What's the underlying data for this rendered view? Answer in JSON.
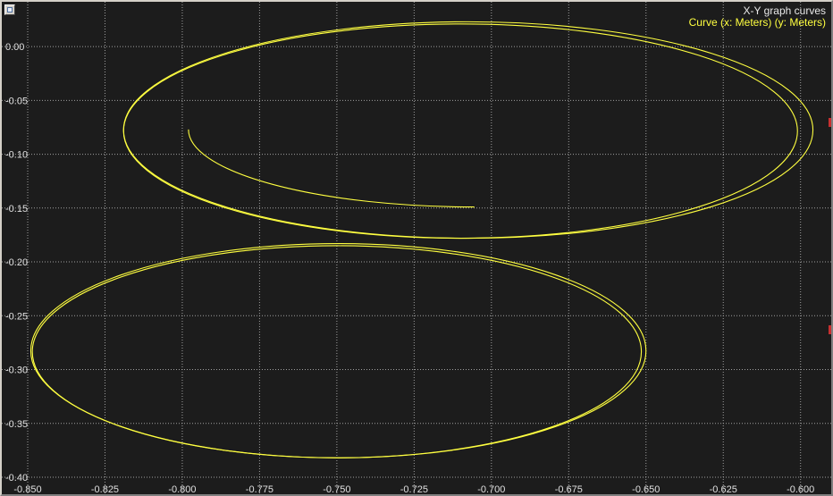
{
  "window": {
    "title": "X-Y graph curves",
    "accent_colors": {
      "background": "#1c1c1c",
      "grid": "#a0a0a0",
      "curve": "#ffff40",
      "text": "#e0e0e0"
    }
  },
  "legend": {
    "entry": "Curve (x: Meters) (y: Meters)"
  },
  "chart_data": {
    "type": "line",
    "title": "X-Y graph curves",
    "xlabel": "",
    "ylabel": "",
    "xlim": [
      -0.85,
      -0.595
    ],
    "ylim": [
      -0.4,
      0.02
    ],
    "grid": true,
    "legend_placement": "top-right",
    "x_ticks": [
      "-0.850",
      "-0.825",
      "-0.800",
      "-0.775",
      "-0.750",
      "-0.725",
      "-0.700",
      "-0.675",
      "-0.650",
      "-0.625",
      "-0.600"
    ],
    "x_tick_values": [
      -0.85,
      -0.825,
      -0.8,
      -0.775,
      -0.75,
      -0.725,
      -0.7,
      -0.675,
      -0.65,
      -0.625,
      -0.6
    ],
    "y_ticks": [
      "0.00",
      "-0.05",
      "-0.10",
      "-0.15",
      "-0.20",
      "-0.25",
      "-0.30",
      "-0.35",
      "-0.40"
    ],
    "y_tick_values": [
      0.0,
      -0.05,
      -0.1,
      -0.15,
      -0.2,
      -0.25,
      -0.3,
      -0.35,
      -0.4
    ],
    "series": [
      {
        "name": "Curve (x: Meters) (y: Meters)",
        "color": "#ffff40",
        "loops": [
          {
            "cx": -0.7075,
            "cy": -0.0775,
            "rx": 0.1115,
            "ry": 0.1005
          },
          {
            "cx": -0.71,
            "cy": -0.0785,
            "rx": 0.109,
            "ry": 0.0995
          },
          {
            "cx": -0.7055,
            "cy": -0.077,
            "rx": 0.0925,
            "ry": 0.072,
            "start_deg": 90,
            "end_deg": 180
          },
          {
            "cx": -0.7495,
            "cy": -0.2825,
            "rx": 0.0995,
            "ry": 0.0995
          },
          {
            "cx": -0.75,
            "cy": -0.2835,
            "rx": 0.0985,
            "ry": 0.0985
          }
        ]
      }
    ]
  }
}
